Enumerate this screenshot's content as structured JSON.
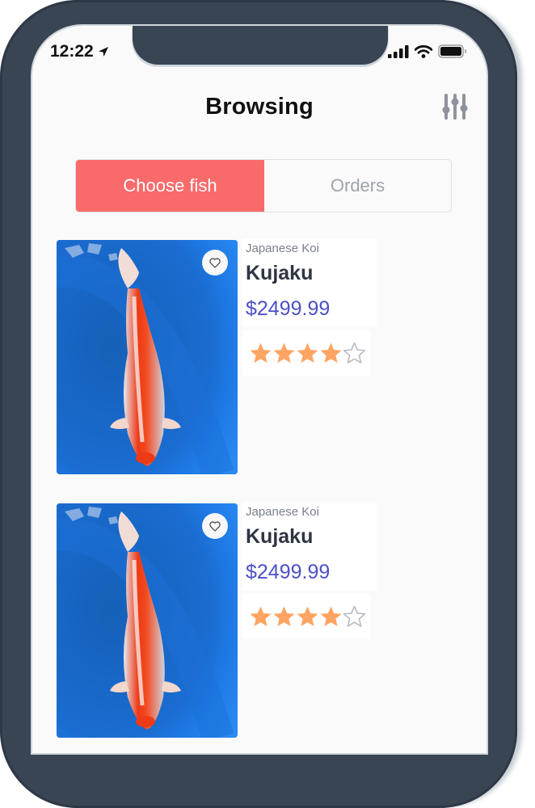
{
  "status_bar": {
    "time": "12:22",
    "location_icon": "location-arrow-icon",
    "signal_icon": "cellular-signal-icon",
    "wifi_icon": "wifi-icon",
    "battery_icon": "battery-full-icon"
  },
  "header": {
    "title": "Browsing",
    "filter_icon": "sliders-icon"
  },
  "segmented_control": {
    "tabs": [
      {
        "label": "Choose fish",
        "active": true
      },
      {
        "label": "Orders",
        "active": false
      }
    ]
  },
  "colors": {
    "accent": "#f96a6b",
    "price": "#4e4fc7",
    "star_filled": "#ffa463",
    "star_empty": "#b9bcc4",
    "frame": "#3a4554"
  },
  "products": [
    {
      "category": "Japanese Koi",
      "name": "Kujaku",
      "price": "$2499.99",
      "rating": 4,
      "rating_max": 5,
      "favorite_icon": "heart-outline-icon"
    },
    {
      "category": "Japanese Koi",
      "name": "Kujaku",
      "price": "$2499.99",
      "rating": 4,
      "rating_max": 5,
      "favorite_icon": "heart-outline-icon"
    }
  ]
}
